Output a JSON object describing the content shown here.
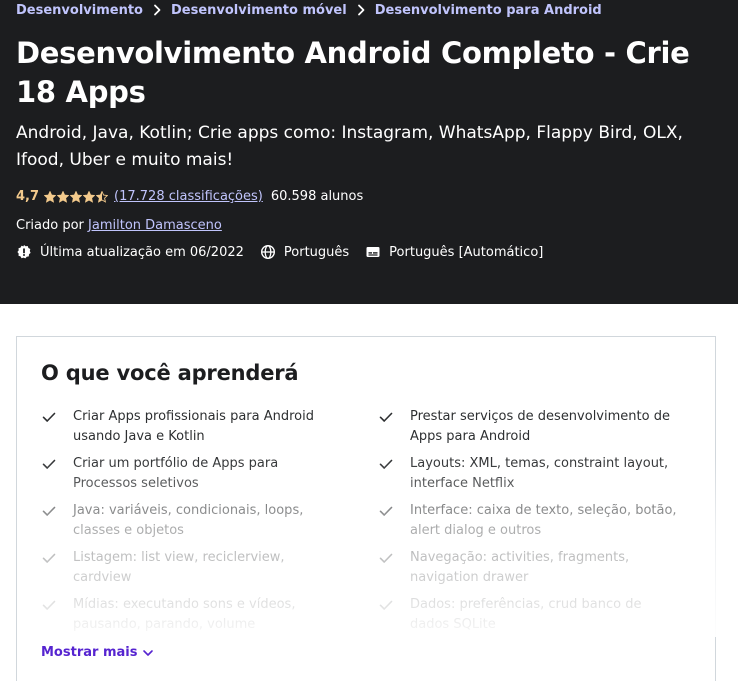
{
  "breadcrumb": [
    "Desenvolvimento",
    "Desenvolvimento móvel",
    "Desenvolvimento para Android"
  ],
  "course": {
    "title": "Desenvolvimento Android Completo - Crie 18 Apps",
    "subtitle": "Android, Java, Kotlin; Crie apps como: Instagram, WhatsApp, Flappy Bird, OLX, Ifood, Uber e muito mais!",
    "rating": "4,7",
    "rating_stars": 4.5,
    "ratings_count": "(17.728 classificações)",
    "students": "60.598 alunos",
    "created_by_label": "Criado por",
    "instructor": "Jamilton Damasceno",
    "last_updated": "Última atualização em 06/2022",
    "language": "Português",
    "captions": "Português [Automático]"
  },
  "learn": {
    "heading": "O que você aprenderá",
    "items": [
      "Criar Apps profissionais para Android usando Java e Kotlin",
      "Prestar serviços de desenvolvimento de Apps para Android",
      "Criar um portfólio de Apps para Processos seletivos",
      "Layouts: XML, temas, constraint layout, interface Netflix",
      "Java: variáveis, condicionais, loops, classes e objetos",
      "Interface: caixa de texto, seleção, botão, alert dialog e outros",
      "Listagem: list view, reciclerview, cardview",
      "Navegação: activities, fragments, navigation drawer",
      "Mídias: executando sons e vídeos, pausando, parando, volume",
      "Dados: preferências, crud banco de dados SQLite"
    ],
    "show_more": "Mostrar mais"
  },
  "colors": {
    "hero_bg": "#1c1d1f",
    "link_purple_light": "#c0c4fc",
    "rating_orange": "#f3ca8c",
    "accent_purple": "#5624d0"
  },
  "icons": {
    "breadcrumb_separator": "chevron-right-icon",
    "rating": "star-icon",
    "last_updated": "alert-badge-icon",
    "language": "globe-icon",
    "captions": "closed-captions-icon",
    "learn_item": "check-icon",
    "show_more": "chevron-down-icon"
  }
}
